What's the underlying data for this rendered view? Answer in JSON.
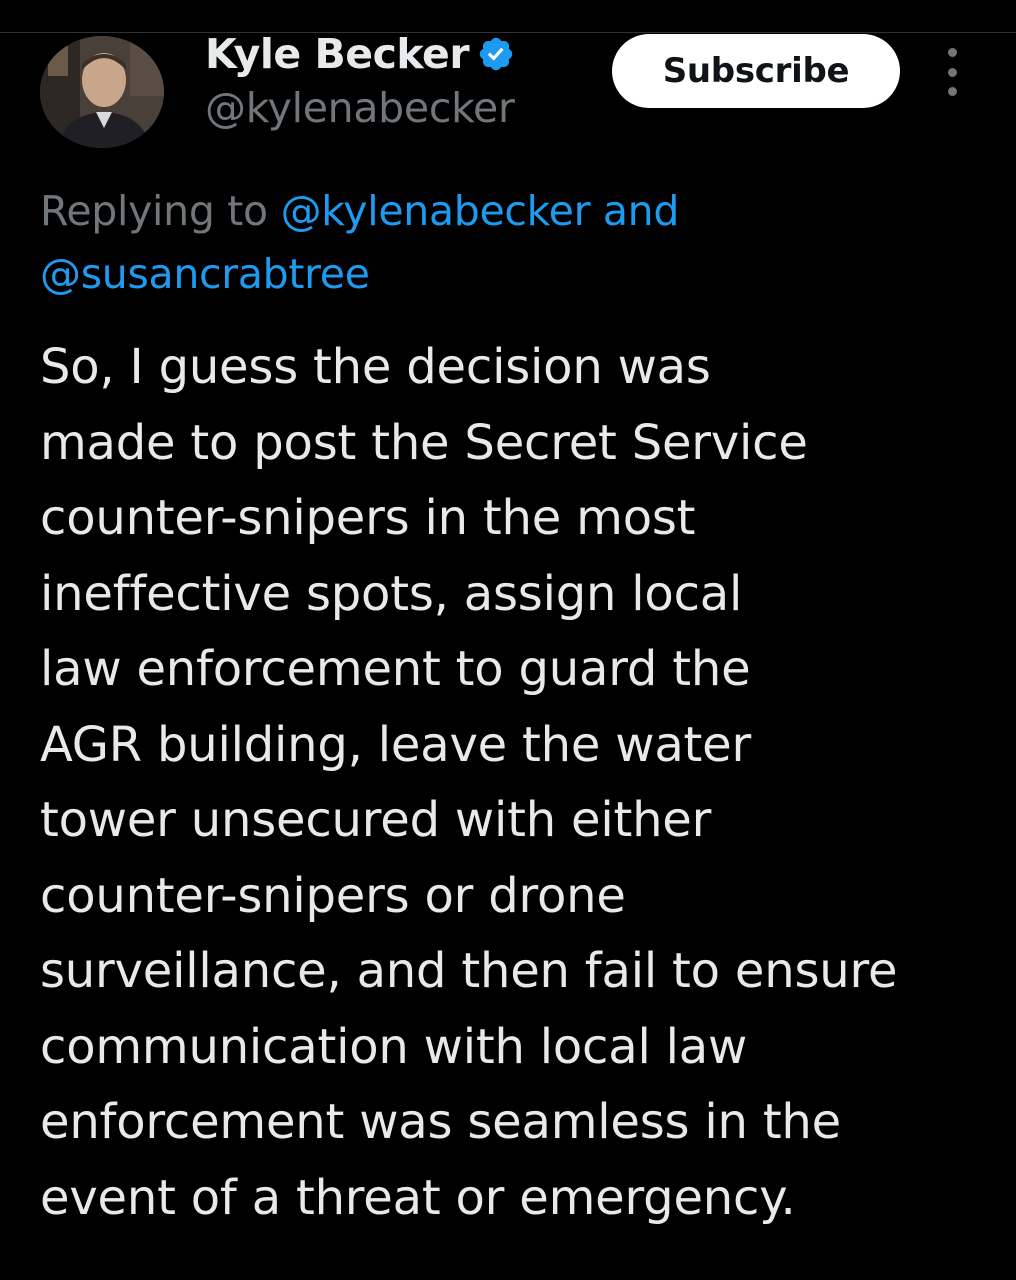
{
  "author": {
    "display_name": "Kyle Becker",
    "handle": "@kylenabecker",
    "verified": true
  },
  "subscribe_label": "Subscribe",
  "reply_context": {
    "prefix": "Replying to",
    "mention_1": "@kylenabecker",
    "conjunction": "and",
    "mention_2": "@susancrabtree"
  },
  "tweet": {
    "lines": [
      "So, I guess the decision was",
      "made to post the Secret Service",
      "counter-snipers in the most",
      "ineffective spots, assign local",
      "law enforcement to guard the",
      "AGR building, leave the water",
      "tower unsecured with either",
      "counter-snipers or drone",
      "surveillance, and then fail to ensure",
      "communication with local law",
      "enforcement was seamless in the",
      "event of a threat or emergency."
    ]
  },
  "icons": {
    "verified": "verified-badge-icon",
    "more": "more-options-icon"
  },
  "colors": {
    "background": "#000000",
    "text": "#e7e9ea",
    "secondary": "#71767b",
    "accent": "#1d9bf0",
    "button_bg": "#ffffff"
  }
}
